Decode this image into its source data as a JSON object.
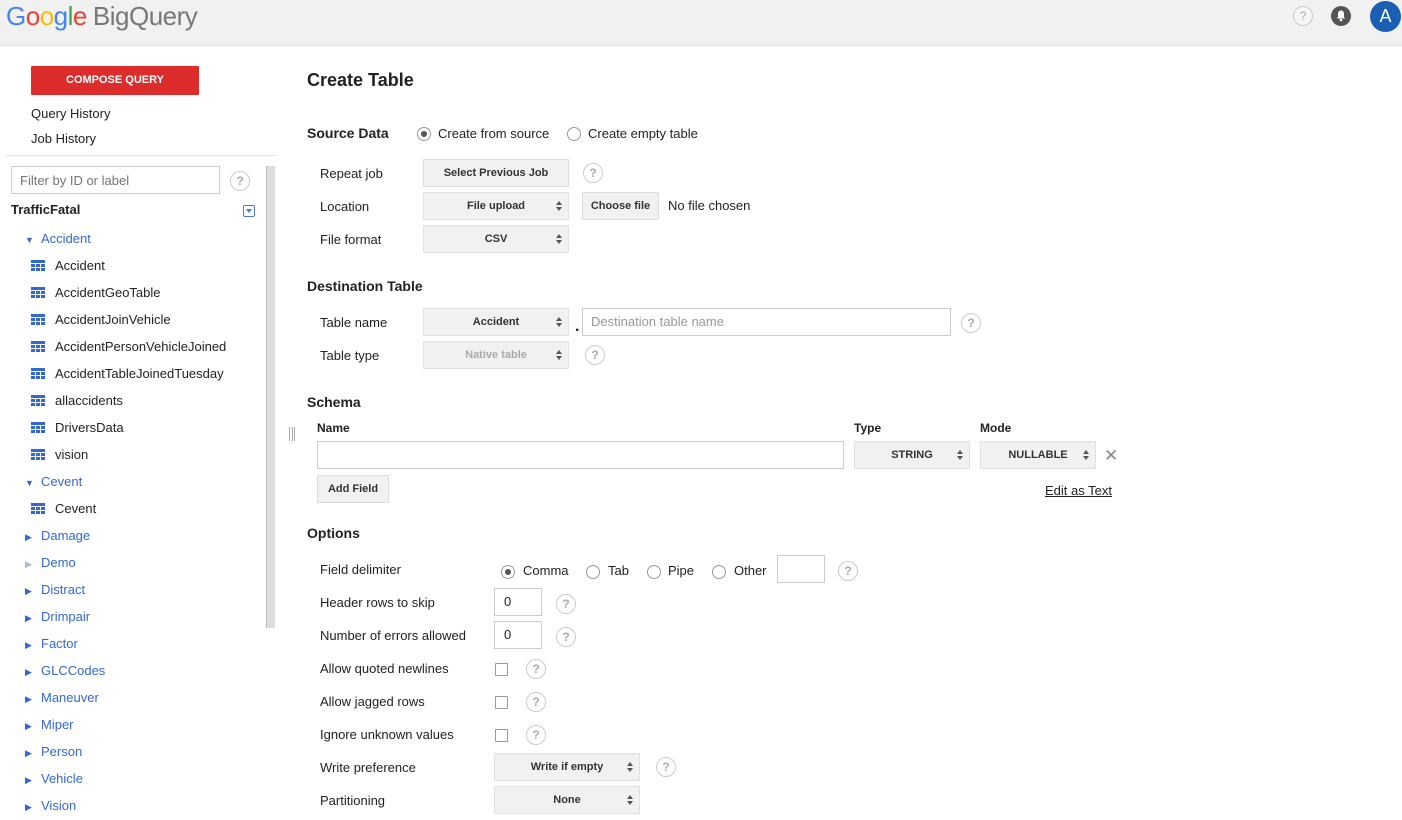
{
  "header": {
    "logo_google": [
      "G",
      "o",
      "o",
      "g",
      "l",
      "e"
    ],
    "product": "BigQuery",
    "help_symbol": "?",
    "avatar_letter": "A"
  },
  "sidebar": {
    "compose_label": "COMPOSE QUERY",
    "query_history": "Query History",
    "job_history": "Job History",
    "filter_placeholder": "Filter by ID or label",
    "help_symbol": "?",
    "project": "TrafficFatal",
    "datasets": [
      {
        "name": "Accident",
        "expanded": true,
        "tables": [
          "Accident",
          "AccidentGeoTable",
          "AccidentJoinVehicle",
          "AccidentPersonVehicleJoined",
          "AccidentTableJoinedTuesday",
          "allaccidents",
          "DriversData",
          "vision"
        ]
      },
      {
        "name": "Cevent",
        "expanded": true,
        "tables": [
          "Cevent"
        ]
      },
      {
        "name": "Damage",
        "expanded": false
      },
      {
        "name": "Demo",
        "expanded": false
      },
      {
        "name": "Distract",
        "expanded": false
      },
      {
        "name": "Drimpair",
        "expanded": false
      },
      {
        "name": "Factor",
        "expanded": false
      },
      {
        "name": "GLCCodes",
        "expanded": false
      },
      {
        "name": "Maneuver",
        "expanded": false
      },
      {
        "name": "Miper",
        "expanded": false
      },
      {
        "name": "Person",
        "expanded": false
      },
      {
        "name": "Vehicle",
        "expanded": false
      },
      {
        "name": "Vision",
        "expanded": false
      }
    ],
    "tri_down": "▼",
    "tri_right": "▶"
  },
  "main": {
    "title": "Create Table",
    "source": {
      "heading": "Source Data",
      "radio_from_source": "Create from source",
      "radio_empty": "Create empty table",
      "repeat_job_label": "Repeat job",
      "select_previous_job": "Select Previous Job",
      "location_label": "Location",
      "location_value": "File upload",
      "choose_file": "Choose file",
      "no_file": "No file chosen",
      "file_format_label": "File format",
      "file_format_value": "CSV"
    },
    "destination": {
      "heading": "Destination Table",
      "table_name_label": "Table name",
      "dataset_value": "Accident",
      "dot": ".",
      "table_name_placeholder": "Destination table name",
      "table_type_label": "Table type",
      "table_type_value": "Native table"
    },
    "schema": {
      "heading": "Schema",
      "col_name": "Name",
      "col_type": "Type",
      "col_mode": "Mode",
      "type_value": "STRING",
      "mode_value": "NULLABLE",
      "add_field": "Add Field",
      "edit_as_text": "Edit as Text",
      "remove_symbol": "✕"
    },
    "options": {
      "heading": "Options",
      "field_delimiter_label": "Field delimiter",
      "delim_comma": "Comma",
      "delim_tab": "Tab",
      "delim_pipe": "Pipe",
      "delim_other": "Other",
      "header_rows_label": "Header rows to skip",
      "header_rows_value": "0",
      "errors_label": "Number of errors allowed",
      "errors_value": "0",
      "quoted_newlines_label": "Allow quoted newlines",
      "jagged_rows_label": "Allow jagged rows",
      "ignore_unknown_label": "Ignore unknown values",
      "write_pref_label": "Write preference",
      "write_pref_value": "Write if empty",
      "partitioning_label": "Partitioning",
      "partitioning_value": "None"
    }
  }
}
